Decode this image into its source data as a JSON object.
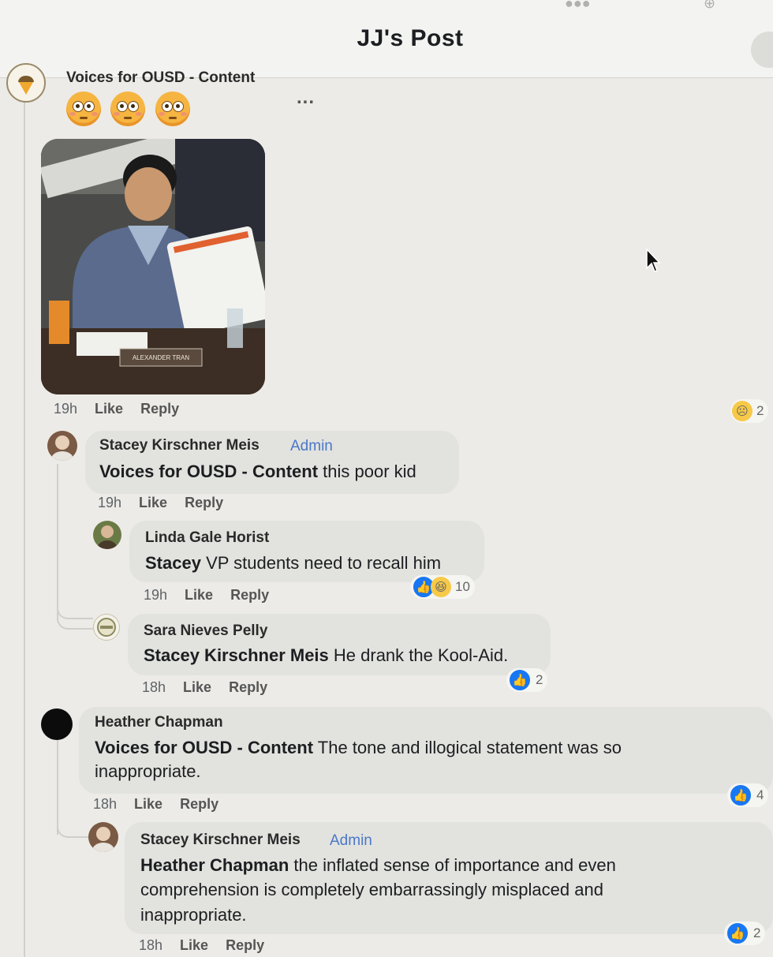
{
  "header": {
    "title": "JJ's Post"
  },
  "post_comment": {
    "author": "Voices for OUSD - Content",
    "emojis": [
      "flushed-face",
      "flushed-face",
      "flushed-face"
    ],
    "more": "...",
    "photo_nameplate": "ALEXANDER TRAN",
    "time": "19h",
    "like": "Like",
    "reply": "Reply",
    "reaction_icon": "sad-face",
    "reaction_count": "2"
  },
  "comments": [
    {
      "author": "Stacey Kirschner Meis",
      "badge": "Admin",
      "mention": "Voices for OUSD - Content",
      "text": " this poor kid",
      "time": "19h",
      "like": "Like",
      "reply": "Reply"
    },
    {
      "author": "Linda Gale Horist",
      "mention": "Stacey",
      "text": " VP students need to recall him",
      "time": "19h",
      "like": "Like",
      "reply": "Reply",
      "reaction_count": "10"
    },
    {
      "author": "Sara Nieves Pelly",
      "mention": "Stacey Kirschner Meis",
      "text": " He drank the Kool-Aid.",
      "time": "18h",
      "like": "Like",
      "reply": "Reply",
      "reaction_count": "2"
    },
    {
      "author": "Heather Chapman",
      "mention": "Voices for OUSD - Content",
      "text_line1": " The tone and illogical statement was so",
      "text_line2": "inappropriate.",
      "time": "18h",
      "like": "Like",
      "reply": "Reply",
      "reaction_count": "4"
    },
    {
      "author": "Stacey Kirschner Meis",
      "badge": "Admin",
      "mention": "Heather Chapman",
      "text_line1": " the inflated sense of importance and even",
      "text_line2": "comprehension is completely embarrassingly misplaced and",
      "text_line3": "inappropriate.",
      "time": "18h",
      "like": "Like",
      "reply": "Reply",
      "reaction_count": "2"
    }
  ],
  "colors": {
    "like_blue": "#1877f2",
    "admin_blue": "#4a78c8",
    "bubble": "#e2e2de"
  }
}
